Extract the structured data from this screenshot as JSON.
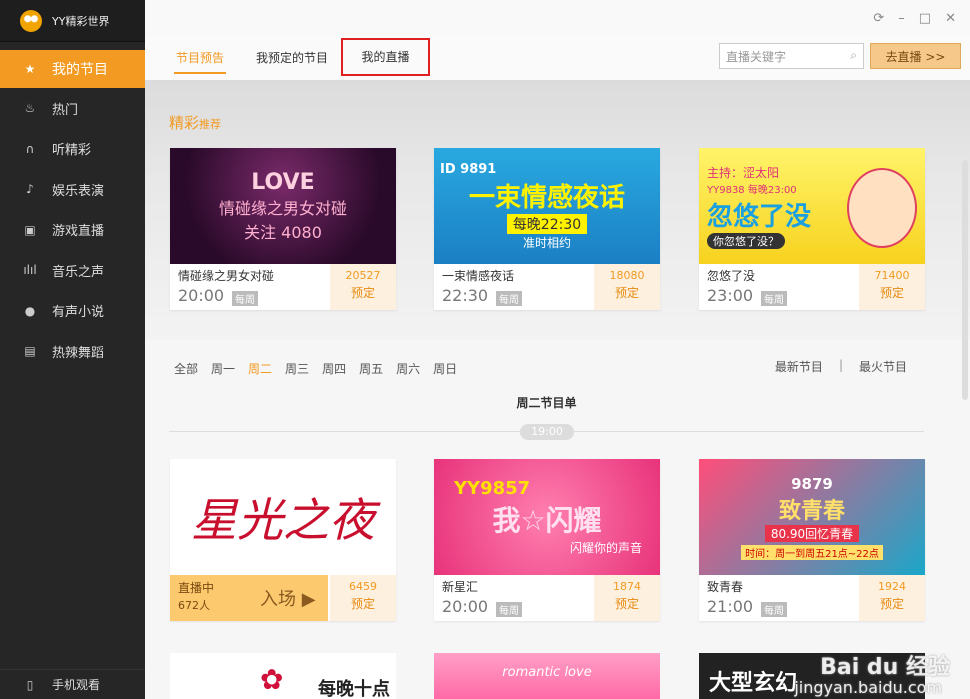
{
  "app": {
    "title": "YY精彩世界"
  },
  "sidebar": {
    "items": [
      {
        "label": "我的节目",
        "icon": "star-icon",
        "active": true
      },
      {
        "label": "热门",
        "icon": "flame-icon"
      },
      {
        "label": "听精彩",
        "icon": "headphones-icon"
      },
      {
        "label": "娱乐表演",
        "icon": "music-note-icon"
      },
      {
        "label": "游戏直播",
        "icon": "gamepad-icon"
      },
      {
        "label": "音乐之声",
        "icon": "equalizer-icon"
      },
      {
        "label": "有声小说",
        "icon": "book-icon"
      },
      {
        "label": "热辣舞蹈",
        "icon": "dance-icon"
      }
    ],
    "bottom": "手机观看"
  },
  "tabs": [
    "节目预告",
    "我预定的节目",
    "我的直播"
  ],
  "search": {
    "placeholder": "直播关键字"
  },
  "golive": "去直播 >>",
  "featured": {
    "title_main": "精彩",
    "title_sub": "推荐",
    "cards": [
      {
        "name": "情碰缘之男女对碰",
        "time": "20:00",
        "weekly": "每周",
        "count": "20527",
        "book": "预定",
        "img_lines": [
          "LOVE",
          "情碰缘之男女对碰",
          "关注 4080"
        ]
      },
      {
        "name": "一束情感夜话",
        "time": "22:30",
        "weekly": "每周",
        "count": "18080",
        "book": "预定",
        "img_lines": [
          "ID 9891",
          "一束情感夜话",
          "每晚22:30",
          "准时相约"
        ]
      },
      {
        "name": "忽悠了没",
        "time": "23:00",
        "weekly": "每周",
        "count": "71400",
        "book": "预定",
        "img_lines": [
          "主持：涩太阳",
          "YY9838 每晚23:00",
          "忽悠了没",
          "你忽悠了没？"
        ]
      }
    ]
  },
  "filters": [
    "全部",
    "周一",
    "周二",
    "周三",
    "周四",
    "周五",
    "周六",
    "周日"
  ],
  "filter_active": "周二",
  "sort": {
    "newest": "最新节目",
    "sep": "|",
    "hottest": "最火节目"
  },
  "schedule_title": "周二节目单",
  "time_slot": "19:00",
  "schedule": [
    {
      "live": true,
      "live_label": "直播中",
      "viewers": "672人",
      "enter": "入场 ▶",
      "count": "6459",
      "book": "预定",
      "img_lines": [
        "星光之夜"
      ]
    },
    {
      "name": "新星汇",
      "time": "20:00",
      "weekly": "每周",
      "count": "1874",
      "book": "预定",
      "img_lines": [
        "YY9857",
        "我☆闪耀",
        "闪耀你的声音"
      ]
    },
    {
      "name": "致青春",
      "time": "21:00",
      "weekly": "每周",
      "count": "1924",
      "book": "预定",
      "img_lines": [
        "9879",
        "致青春",
        "80.90回忆青春",
        "时间：周一到周五21点~22点"
      ]
    }
  ],
  "bottom_row": [
    "每晚十点",
    "romantic love",
    "大型玄幻"
  ],
  "watermark": {
    "line1": "Bai du 经验",
    "line2": "jingyan.baidu.com"
  }
}
